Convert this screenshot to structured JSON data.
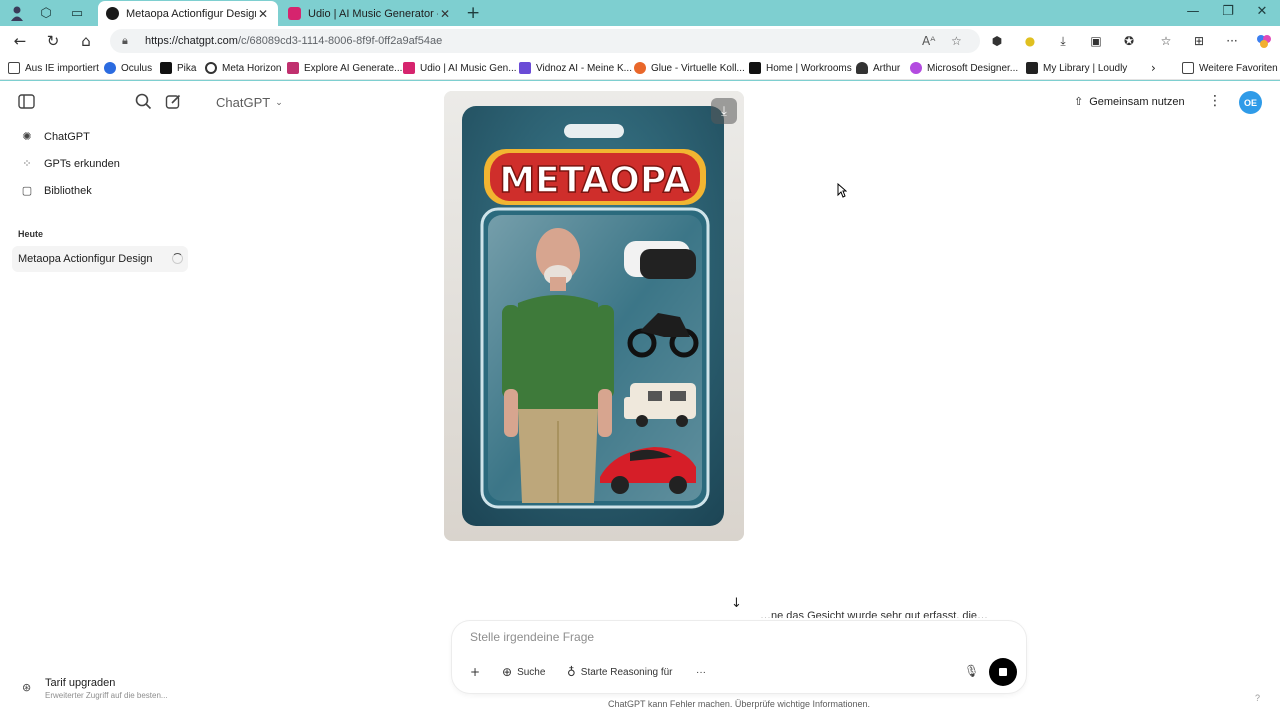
{
  "browser": {
    "tabs": [
      {
        "title": "Metaopa Actionfigur Design",
        "active": true,
        "favicon_color": "#1a1a1a"
      },
      {
        "title": "Udio | AI Music Generator - Offic",
        "active": false,
        "favicon_color": "#d6246e"
      }
    ],
    "new_tab": "+",
    "url_host": "https://chatgpt.com",
    "url_path": "/c/68089cd3-1114-8006-8f9f-0ff2a9af54ae",
    "bookmarks": [
      {
        "label": "Aus IE importiert",
        "color": "#f0c24a"
      },
      {
        "label": "Oculus",
        "color": "#2b6be0"
      },
      {
        "label": "Pika",
        "color": "#111111"
      },
      {
        "label": "Meta Horizon",
        "color": "#333333"
      },
      {
        "label": "Explore AI Generate...",
        "color": "#c0306e"
      },
      {
        "label": "Udio | AI Music Gen...",
        "color": "#d6246e"
      },
      {
        "label": "Vidnoz AI - Meine K...",
        "color": "#6a4bd6"
      },
      {
        "label": "Glue - Virtuelle Koll...",
        "color": "#e9672a"
      },
      {
        "label": "Home | Workrooms",
        "color": "#111111"
      },
      {
        "label": "Arthur",
        "color": "#333333"
      },
      {
        "label": "Microsoft Designer...",
        "color": "#b34be0"
      },
      {
        "label": "My Library | Loudly",
        "color": "#222222"
      }
    ],
    "more_favorites": "Weitere Favoriten"
  },
  "sidebar": {
    "items": [
      {
        "label": "ChatGPT",
        "icon": "openai-icon"
      },
      {
        "label": "GPTs erkunden",
        "icon": "grid-icon"
      },
      {
        "label": "Bibliothek",
        "icon": "library-icon"
      }
    ],
    "section_today": "Heute",
    "active_chat": "Metaopa Actionfigur Design",
    "upgrade_title": "Tarif upgraden",
    "upgrade_subtitle": "Erweiterter Zugriff auf die besten..."
  },
  "header": {
    "model": "ChatGPT",
    "share_label": "Gemeinsam nutzen",
    "avatar_initials": "OE",
    "avatar_color": "#2f9be8"
  },
  "image": {
    "brand_text": "METAOPA",
    "accessories": [
      "vr-headset",
      "motorcycle",
      "camper-van",
      "red-sports-car"
    ]
  },
  "composer": {
    "placeholder": "Stelle irgendeine Frage",
    "search_label": "Suche",
    "reasoning_label": "Starte Reasoning für",
    "more": "···"
  },
  "ghost_text": "…ne das Gesicht wurde sehr gut erfasst, die…",
  "disclaimer": "ChatGPT kann Fehler machen. Überprüfe wichtige Informationen.",
  "help": "?"
}
